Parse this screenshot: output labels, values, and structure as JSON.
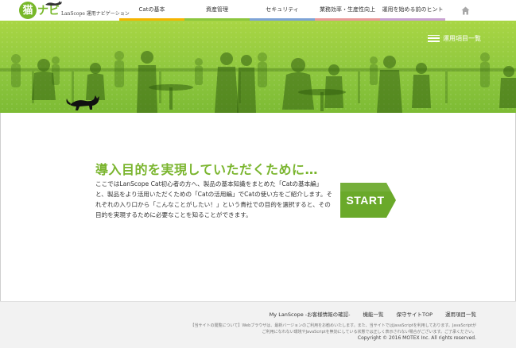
{
  "header": {
    "logo_mark": "猫",
    "logo_kana": "ナビ",
    "logo_text": "LanScope 運用ナビゲーション",
    "nav": [
      {
        "label": "Catの基本",
        "color": "#f5b400"
      },
      {
        "label": "資産管理",
        "color": "#8cc63e"
      },
      {
        "label": "セキュリティ",
        "color": "#7ea3d6"
      },
      {
        "label": "業務効率・生産性向上",
        "color": "#e99a9a"
      },
      {
        "label": "運用を始める前のヒント",
        "color": "#c9a2d3"
      }
    ],
    "home_icon": "home-icon"
  },
  "hero": {
    "menu_label": "運用項目一覧",
    "menu_icon": "hamburger-icon"
  },
  "main": {
    "title": "導入目的を実現していただくために…",
    "intro": "ここではLanScope Cat初心者の方へ、製品の基本知識をまとめた「Catの基本編」と、製品をより活用いただくための「Catの活用編」でCatの使い方をご紹介します。それぞれの入り口から「こんなことがしたい！」という貴社での目的を選択すると、その目的を実現するために必要なことを知ることができます。",
    "start_label": "START"
  },
  "footer": {
    "links": [
      "My LanScope -お客様情報の確認-",
      "機能一覧",
      "保守サイトTOP",
      "運用項目一覧"
    ],
    "note": "【当サイトの閲覧について】Webブラウザは、最新バージョンのご利用をお勧めいたします。また、当サイトではJavaScriptを利用しております。JavaScriptがご利用になれない環境やJavaScriptを無効にしている状態では正しく表示されない場合がございます。ご了承ください。",
    "copyright": "Copyright © 2016 MOTEX Inc. All rights reserved."
  },
  "colors": {
    "brand_green": "#7ab52e",
    "hero_green": "#8cc63e",
    "start_green": "#6aa92a"
  }
}
